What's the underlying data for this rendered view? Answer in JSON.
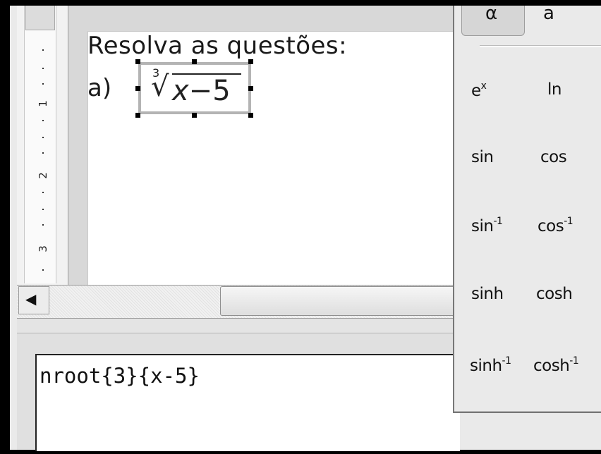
{
  "document": {
    "heading": "Resolva as questões:",
    "item_label": "a)"
  },
  "formula": {
    "index": "3",
    "radical_symbol": "√",
    "radicand_var": "x",
    "radicand_rest": "−5"
  },
  "ruler": {
    "labels": [
      "1",
      "2",
      "3"
    ]
  },
  "command": {
    "text": "nroot{3}{x-5}"
  },
  "elements_panel": {
    "tabs": [
      "α",
      "a"
    ],
    "rows": [
      [
        {
          "base": "e",
          "sup": "x"
        },
        {
          "base": "ln",
          "sup": ""
        }
      ],
      [
        {
          "base": "sin",
          "sup": ""
        },
        {
          "base": "cos",
          "sup": ""
        }
      ],
      [
        {
          "base": "sin",
          "sup": "-1"
        },
        {
          "base": "cos",
          "sup": "-1"
        }
      ],
      [
        {
          "base": "sinh",
          "sup": ""
        },
        {
          "base": "cosh",
          "sup": ""
        }
      ],
      [
        {
          "base": "sinh",
          "sup": "-1"
        },
        {
          "base": "cosh",
          "sup": "-1"
        }
      ]
    ]
  },
  "colors": {
    "frame": "#000000",
    "page": "#ffffff",
    "selection_border": "#b4b4b4"
  },
  "icons": {
    "scroll_left": "triangle-left-icon"
  }
}
